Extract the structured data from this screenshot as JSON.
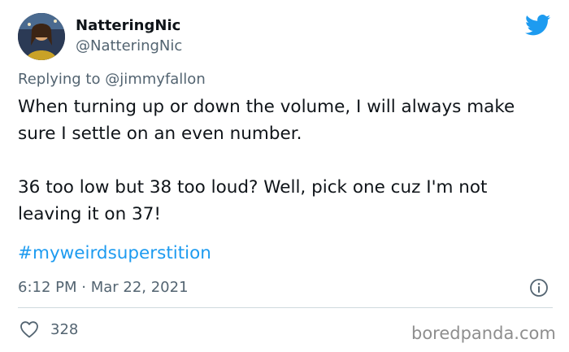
{
  "tweet": {
    "display_name": "NatteringNic",
    "handle": "@NatteringNic",
    "reply_prefix": "Replying to",
    "reply_to": "@jimmyfallon",
    "text": "When turning up or down the volume, I will always make sure I settle on an even number.\n\n36 too low but 38 too loud?  Well, pick one cuz I'm not leaving it on 37!",
    "hashtag": "#myweirdsuperstition",
    "timestamp": "6:12 PM · Mar 22, 2021",
    "like_count": "328"
  },
  "icons": {
    "brand": "twitter-bird-icon",
    "info": "info-icon",
    "like": "heart-icon"
  },
  "watermark": "boredpanda.com",
  "colors": {
    "accent": "#1d9bf0",
    "text": "#0f1419",
    "secondary": "#536471"
  }
}
